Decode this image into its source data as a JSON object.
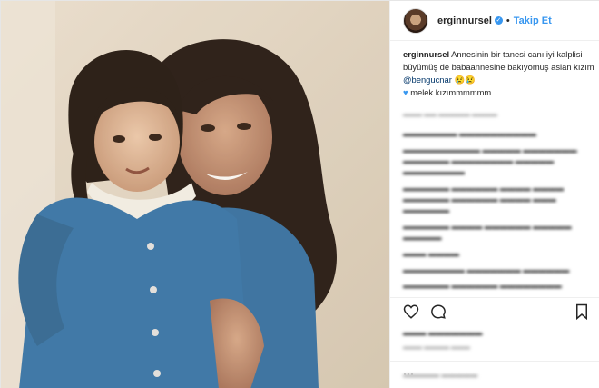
{
  "post": {
    "username": "erginnursel",
    "follow_label": "Takip Et",
    "caption_user": "erginnursel",
    "caption_text": "Annesinin bir tanesi canı iyi kalplisi büyümüş de babaannesine bakıyomuş aslan kızım",
    "mention": "@bengucnar",
    "caption_emoji": "😢😢",
    "caption_line2": "melek kızımmmmmm"
  },
  "colors": {
    "accent": "#3897f0",
    "text": "#262626",
    "muted": "#999999"
  },
  "icons": [
    "verified-badge-icon",
    "heart-icon",
    "comment-icon",
    "bookmark-icon",
    "more-options-icon"
  ]
}
